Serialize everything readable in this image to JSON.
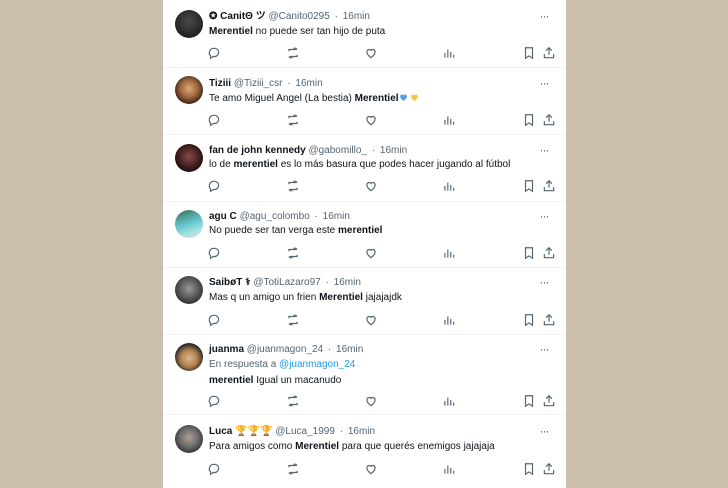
{
  "tweets": [
    {
      "name": "✪ CanitΘ ツ",
      "handle": "@Canito0295",
      "time": "16min",
      "text_before": "",
      "mention": "Merentiel",
      "text_after": " no puede ser tan hijo de puta",
      "avatar_colors": [
        "#1a1a1a",
        "#3a3a3a"
      ]
    },
    {
      "name": "Tiziii",
      "handle": "@Tiziii_csr",
      "time": "16min",
      "text_before": "Te amo Miguel Angel (La bestia) ",
      "mention": "Merentiel",
      "text_after": "",
      "emoji": [
        "blue-heart",
        "yellow-heart"
      ],
      "emoji_colors": [
        "#4fa3e0",
        "#f4c542"
      ],
      "avatar_colors": [
        "#c98a5c",
        "#4a2a1a"
      ]
    },
    {
      "name": "fan de john kennedy",
      "handle": "@gabomillo_",
      "time": "16min",
      "text_before": "lo de ",
      "mention": "merentiel",
      "text_after": " es lo más basura que podes hacer jugando al fútbol",
      "avatar_colors": [
        "#2a1a1a",
        "#7a3a3a"
      ]
    },
    {
      "name": "agu C",
      "handle": "@agu_colombo",
      "time": "16min",
      "text_before": "No puede ser tan verga este ",
      "mention": "merentiel",
      "text_after": "",
      "avatar_colors": [
        "#5fc2c7",
        "#3a6a4a"
      ]
    },
    {
      "name": "SaibøT ⚕",
      "handle": "@TotiLazaro97",
      "time": "16min",
      "text_before": "Mas q un amigo un frien ",
      "mention": "Merentiel",
      "text_after": " jajajajdk",
      "avatar_colors": [
        "#6a6a6a",
        "#2a2a2a"
      ]
    },
    {
      "name": "juanma",
      "handle": "@juanmagon_24",
      "time": "16min",
      "reply_label": "En respuesta a ",
      "reply_handle": "@juanmagon_24",
      "text_before": "",
      "mention": "merentiel",
      "text_after": " Igual un macanudo",
      "avatar_colors": [
        "#d8b080",
        "#2a2a2a"
      ]
    },
    {
      "name": "Luca 🏆🏆🏆",
      "handle": "@Luca_1999",
      "time": "16min",
      "text_before": "Para amigos como ",
      "mention": "Merentiel",
      "text_after": " para que querés enemigos jajajaja",
      "avatar_colors": [
        "#8a8a8a",
        "#3a3a3a"
      ]
    }
  ],
  "more_label": "···",
  "handle_sep": "·",
  "colors": {
    "background": "#cdbfae",
    "card": "#ffffff",
    "text": "#0f1419",
    "muted": "#536471",
    "link": "#1d9bf0"
  }
}
